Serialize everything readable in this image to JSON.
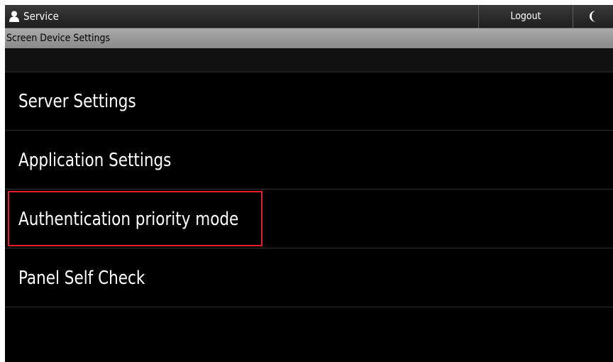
{
  "header": {
    "user_name": "Service",
    "logout_label": "Logout",
    "moon_icon": "moon-icon",
    "user_icon": "user-icon"
  },
  "title_bar": {
    "title": "Screen Device Settings"
  },
  "menu": {
    "items": [
      {
        "label": "Server Settings"
      },
      {
        "label": "Application Settings"
      },
      {
        "label": "Authentication priority mode",
        "highlighted": true
      },
      {
        "label": "Panel Self Check"
      }
    ]
  },
  "colors": {
    "background": "#000000",
    "title_bar": "#9a9a9a",
    "highlight": "#e0202a"
  }
}
